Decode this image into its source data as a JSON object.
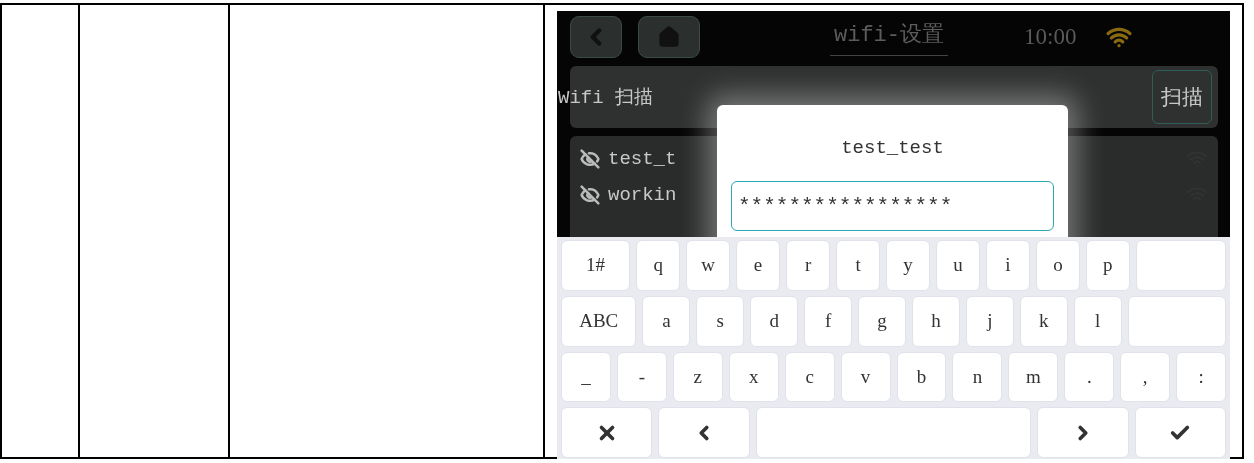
{
  "screen": {
    "title": "wifi-设置",
    "time": "10:00",
    "scan_row": {
      "label": "Wifi 扫描",
      "button": "扫描"
    },
    "networks": [
      {
        "name": "test_t"
      },
      {
        "name": "workin"
      }
    ],
    "dialog": {
      "title": "test_test",
      "value": "*****************"
    },
    "keyboard": {
      "rows": [
        {
          "keys": [
            {
              "kind": "mode",
              "label": "1#"
            },
            {
              "kind": "char",
              "label": "q"
            },
            {
              "kind": "char",
              "label": "w"
            },
            {
              "kind": "char",
              "label": "e"
            },
            {
              "kind": "char",
              "label": "r"
            },
            {
              "kind": "char",
              "label": "t"
            },
            {
              "kind": "char",
              "label": "y"
            },
            {
              "kind": "char",
              "label": "u"
            },
            {
              "kind": "char",
              "label": "i"
            },
            {
              "kind": "char",
              "label": "o"
            },
            {
              "kind": "char",
              "label": "p"
            },
            {
              "kind": "blank"
            }
          ]
        },
        {
          "keys": [
            {
              "kind": "mode",
              "label": "ABC"
            },
            {
              "kind": "char",
              "label": "a"
            },
            {
              "kind": "char",
              "label": "s"
            },
            {
              "kind": "char",
              "label": "d"
            },
            {
              "kind": "char",
              "label": "f"
            },
            {
              "kind": "char",
              "label": "g"
            },
            {
              "kind": "char",
              "label": "h"
            },
            {
              "kind": "char",
              "label": "j"
            },
            {
              "kind": "char",
              "label": "k"
            },
            {
              "kind": "char",
              "label": "l"
            },
            {
              "kind": "blank"
            }
          ]
        },
        {
          "keys": [
            {
              "kind": "char",
              "label": "_"
            },
            {
              "kind": "char",
              "label": "-"
            },
            {
              "kind": "char",
              "label": "z"
            },
            {
              "kind": "char",
              "label": "x"
            },
            {
              "kind": "char",
              "label": "c"
            },
            {
              "kind": "char",
              "label": "v"
            },
            {
              "kind": "char",
              "label": "b"
            },
            {
              "kind": "char",
              "label": "n"
            },
            {
              "kind": "char",
              "label": "m"
            },
            {
              "kind": "char",
              "label": "."
            },
            {
              "kind": "char",
              "label": ","
            },
            {
              "kind": "char",
              "label": ":"
            }
          ]
        },
        {
          "keys": [
            {
              "kind": "close"
            },
            {
              "kind": "left"
            },
            {
              "kind": "space"
            },
            {
              "kind": "right"
            },
            {
              "kind": "ok"
            }
          ]
        }
      ]
    }
  }
}
